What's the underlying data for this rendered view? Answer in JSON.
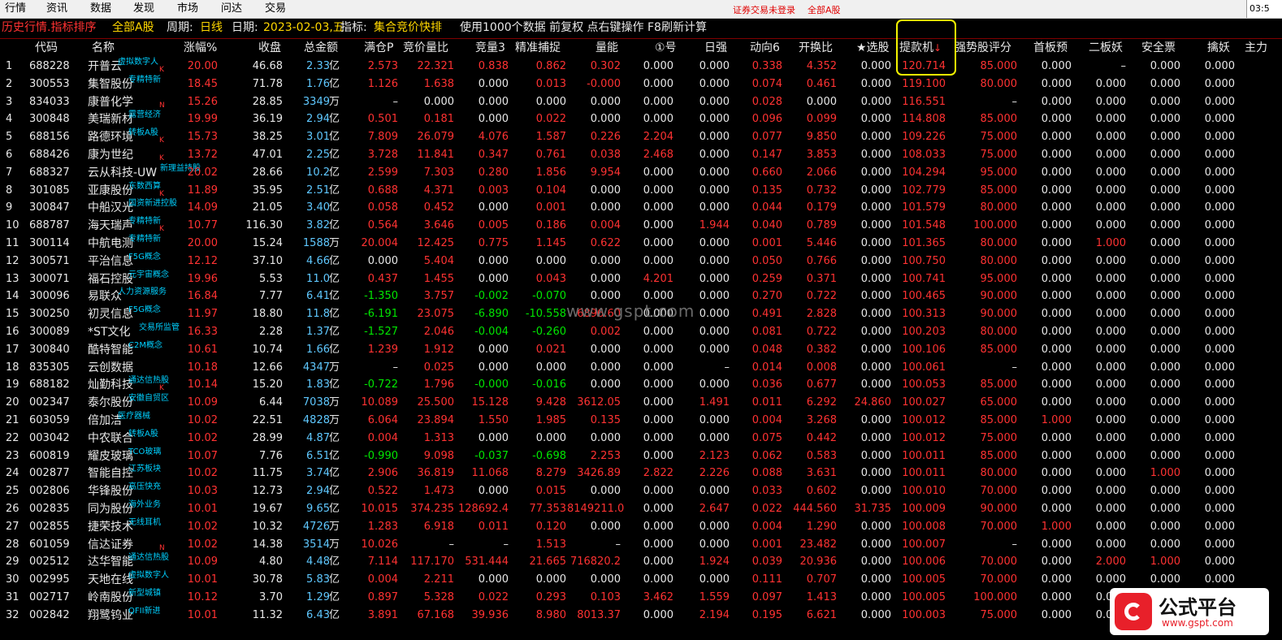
{
  "menu": {
    "items": [
      "行情",
      "资讯",
      "数据",
      "发现",
      "市场",
      "问达",
      "交易"
    ],
    "login_status": "证券交易未登录",
    "market_scope": "全部A股",
    "clock": "03:5"
  },
  "infobar": {
    "mode": "历史行情.指标排序",
    "scope": "全部A股",
    "period_label": "周期:",
    "period_value": "日线",
    "date_label": "日期:",
    "date_value": "2023-02-03,五",
    "indicator_label": "指标:",
    "indicator_value": "集合竞价快排",
    "notes": "使用1000个数据 前复权 点右键操作 F8刷新计算"
  },
  "columns": [
    "代码",
    "名称",
    "涨幅%",
    "收盘",
    "总金额",
    "满仓P",
    "竞价量比",
    "竞量3",
    "精准捕捉",
    "量能",
    "①号",
    "日强",
    "动向6",
    "开换比",
    "★选股",
    "提款机",
    "强势股评分",
    "首板预",
    "二板妖",
    "安全票",
    "擒妖",
    "主力"
  ],
  "sort_arrow": "↓",
  "watermark": "www.gspt.com",
  "logo": {
    "text": "公式平台",
    "url": "www.gspt.com"
  },
  "rows": [
    {
      "i": "1",
      "code": "688228",
      "name": "开普云",
      "tag": "虚拟数字人",
      "flag": "K",
      "chg": "20.00",
      "close": "46.68",
      "amt": "2.33",
      "unit": "亿",
      "mcp": "2.573",
      "jjlb": "22.321",
      "jl3": "0.838",
      "jzbz": "0.862",
      "ln": "0.302",
      "n1": "0.000",
      "rq": "0.000",
      "dx6": "0.338",
      "khb": "4.352",
      "xg": "0.000",
      "tkj": "120.714",
      "qsg": "85.000",
      "sbp": "0.000",
      "ebo": "–",
      "aqp": "0.000",
      "qy": "0.000"
    },
    {
      "i": "2",
      "code": "300553",
      "name": "集智股份",
      "tag": "专精特新",
      "flag": "",
      "chg": "18.45",
      "close": "71.78",
      "amt": "1.76",
      "unit": "亿",
      "mcp": "1.126",
      "jjlb": "1.638",
      "jl3": "0.000",
      "jzbz": "0.013",
      "ln": "-0.000",
      "n1": "0.000",
      "rq": "0.000",
      "dx6": "0.074",
      "khb": "0.461",
      "xg": "0.000",
      "tkj": "119.100",
      "qsg": "80.000",
      "sbp": "0.000",
      "ebo": "0.000",
      "aqp": "0.000",
      "qy": "0.000"
    },
    {
      "i": "3",
      "code": "834033",
      "name": "康普化学",
      "tag": "",
      "flag": "N",
      "chg": "15.26",
      "close": "28.85",
      "amt": "3349",
      "unit": "万",
      "mcp": "–",
      "jjlb": "0.000",
      "jl3": "0.000",
      "jzbz": "0.000",
      "ln": "0.000",
      "n1": "0.000",
      "rq": "0.000",
      "dx6": "0.028",
      "khb": "0.000",
      "xg": "0.000",
      "tkj": "116.551",
      "qsg": "–",
      "sbp": "0.000",
      "ebo": "0.000",
      "aqp": "0.000",
      "qy": "0.000"
    },
    {
      "i": "4",
      "code": "300848",
      "name": "美瑞新材",
      "tag": "露营经济",
      "flag": "",
      "chg": "19.99",
      "close": "36.19",
      "amt": "2.94",
      "unit": "亿",
      "mcp": "0.501",
      "jjlb": "0.181",
      "jl3": "0.000",
      "jzbz": "0.022",
      "ln": "0.000",
      "n1": "0.000",
      "rq": "0.000",
      "dx6": "0.096",
      "khb": "0.099",
      "xg": "0.000",
      "tkj": "114.808",
      "qsg": "85.000",
      "sbp": "0.000",
      "ebo": "0.000",
      "aqp": "0.000",
      "qy": "0.000"
    },
    {
      "i": "5",
      "code": "688156",
      "name": "路德环境",
      "tag": "转板A股",
      "flag": "K",
      "chg": "15.73",
      "close": "38.25",
      "amt": "3.01",
      "unit": "亿",
      "mcp": "7.809",
      "jjlb": "26.079",
      "jl3": "4.076",
      "jzbz": "1.587",
      "ln": "0.226",
      "n1": "2.204",
      "rq": "0.000",
      "dx6": "0.077",
      "khb": "9.850",
      "xg": "0.000",
      "tkj": "109.226",
      "qsg": "75.000",
      "sbp": "0.000",
      "ebo": "0.000",
      "aqp": "0.000",
      "qy": "0.000"
    },
    {
      "i": "6",
      "code": "688426",
      "name": "康为世纪",
      "tag": "",
      "flag": "K",
      "chg": "13.72",
      "close": "47.01",
      "amt": "2.25",
      "unit": "亿",
      "mcp": "3.728",
      "jjlb": "11.841",
      "jl3": "0.347",
      "jzbz": "0.761",
      "ln": "0.038",
      "n1": "2.468",
      "rq": "0.000",
      "dx6": "0.147",
      "khb": "3.853",
      "xg": "0.000",
      "tkj": "108.033",
      "qsg": "75.000",
      "sbp": "0.000",
      "ebo": "0.000",
      "aqp": "0.000",
      "qy": "0.000"
    },
    {
      "i": "7",
      "code": "688327",
      "name": "云从科技-UW",
      "tag": "新理益持股",
      "flag": "",
      "chg": "20.02",
      "close": "28.66",
      "amt": "10.2",
      "unit": "亿",
      "mcp": "2.599",
      "jjlb": "7.303",
      "jl3": "0.280",
      "jzbz": "1.856",
      "ln": "9.954",
      "n1": "0.000",
      "rq": "0.000",
      "dx6": "0.660",
      "khb": "2.066",
      "xg": "0.000",
      "tkj": "104.294",
      "qsg": "95.000",
      "sbp": "0.000",
      "ebo": "0.000",
      "aqp": "0.000",
      "qy": "0.000"
    },
    {
      "i": "8",
      "code": "301085",
      "name": "亚康股份",
      "tag": "东数西算",
      "flag": "K",
      "chg": "11.89",
      "close": "35.95",
      "amt": "2.51",
      "unit": "亿",
      "mcp": "0.688",
      "jjlb": "4.371",
      "jl3": "0.003",
      "jzbz": "0.104",
      "ln": "0.000",
      "n1": "0.000",
      "rq": "0.000",
      "dx6": "0.135",
      "khb": "0.732",
      "xg": "0.000",
      "tkj": "102.779",
      "qsg": "85.000",
      "sbp": "0.000",
      "ebo": "0.000",
      "aqp": "0.000",
      "qy": "0.000"
    },
    {
      "i": "9",
      "code": "300847",
      "name": "中船汉光",
      "tag": "国资新进控股",
      "flag": "",
      "chg": "14.09",
      "close": "21.05",
      "amt": "3.40",
      "unit": "亿",
      "mcp": "0.058",
      "jjlb": "0.452",
      "jl3": "0.000",
      "jzbz": "0.001",
      "ln": "0.000",
      "n1": "0.000",
      "rq": "0.000",
      "dx6": "0.044",
      "khb": "0.179",
      "xg": "0.000",
      "tkj": "101.579",
      "qsg": "80.000",
      "sbp": "0.000",
      "ebo": "0.000",
      "aqp": "0.000",
      "qy": "0.000"
    },
    {
      "i": "10",
      "code": "688787",
      "name": "海天瑞声",
      "tag": "专精特新",
      "flag": "K",
      "chg": "10.77",
      "close": "116.30",
      "amt": "3.82",
      "unit": "亿",
      "mcp": "0.564",
      "jjlb": "3.646",
      "jl3": "0.005",
      "jzbz": "0.186",
      "ln": "0.004",
      "n1": "0.000",
      "rq": "1.944",
      "dx6": "0.040",
      "khb": "0.789",
      "xg": "0.000",
      "tkj": "101.548",
      "qsg": "100.000",
      "sbp": "0.000",
      "ebo": "0.000",
      "aqp": "0.000",
      "qy": "0.000"
    },
    {
      "i": "11",
      "code": "300114",
      "name": "中航电测",
      "tag": "专精特新",
      "flag": "",
      "chg": "20.00",
      "close": "15.24",
      "amt": "1588",
      "unit": "万",
      "mcp": "20.004",
      "jjlb": "12.425",
      "jl3": "0.775",
      "jzbz": "1.145",
      "ln": "0.622",
      "n1": "0.000",
      "rq": "0.000",
      "dx6": "0.001",
      "khb": "5.446",
      "xg": "0.000",
      "tkj": "101.365",
      "qsg": "80.000",
      "sbp": "0.000",
      "ebo": "1.000",
      "aqp": "0.000",
      "qy": "0.000"
    },
    {
      "i": "12",
      "code": "300571",
      "name": "平治信息",
      "tag": "F5G概念",
      "flag": "",
      "chg": "12.12",
      "close": "37.10",
      "amt": "4.66",
      "unit": "亿",
      "mcp": "0.000",
      "jjlb": "5.404",
      "jl3": "0.000",
      "jzbz": "0.000",
      "ln": "0.000",
      "n1": "0.000",
      "rq": "0.000",
      "dx6": "0.050",
      "khb": "0.766",
      "xg": "0.000",
      "tkj": "100.750",
      "qsg": "80.000",
      "sbp": "0.000",
      "ebo": "0.000",
      "aqp": "0.000",
      "qy": "0.000"
    },
    {
      "i": "13",
      "code": "300071",
      "name": "福石控股",
      "tag": "元宇宙概念",
      "flag": "",
      "chg": "19.96",
      "close": "5.53",
      "amt": "11.0",
      "unit": "亿",
      "mcp": "0.437",
      "jjlb": "1.455",
      "jl3": "0.000",
      "jzbz": "0.043",
      "ln": "0.000",
      "n1": "4.201",
      "rq": "0.000",
      "dx6": "0.259",
      "khb": "0.371",
      "xg": "0.000",
      "tkj": "100.741",
      "qsg": "95.000",
      "sbp": "0.000",
      "ebo": "0.000",
      "aqp": "0.000",
      "qy": "0.000"
    },
    {
      "i": "14",
      "code": "300096",
      "name": "易联众",
      "tag": "人力资源服务",
      "flag": "",
      "chg": "16.84",
      "close": "7.77",
      "amt": "6.41",
      "unit": "亿",
      "mcp": "-1.350",
      "jjlb": "3.757",
      "jl3": "-0.002",
      "jzbz": "-0.070",
      "ln": "0.000",
      "n1": "0.000",
      "rq": "0.000",
      "dx6": "0.270",
      "khb": "0.722",
      "xg": "0.000",
      "tkj": "100.465",
      "qsg": "90.000",
      "sbp": "0.000",
      "ebo": "0.000",
      "aqp": "0.000",
      "qy": "0.000"
    },
    {
      "i": "15",
      "code": "300250",
      "name": "初灵信息",
      "tag": "F5G概念",
      "flag": "",
      "chg": "11.97",
      "close": "18.80",
      "amt": "11.8",
      "unit": "亿",
      "mcp": "-6.191",
      "jjlb": "23.075",
      "jl3": "-6.890",
      "jzbz": "-10.558",
      "ln": "6896.60",
      "n1": "0.000",
      "rq": "0.000",
      "dx6": "0.491",
      "khb": "2.828",
      "xg": "0.000",
      "tkj": "100.313",
      "qsg": "90.000",
      "sbp": "0.000",
      "ebo": "0.000",
      "aqp": "0.000",
      "qy": "0.000"
    },
    {
      "i": "16",
      "code": "300089",
      "name": "*ST文化",
      "tag": "交易所监管",
      "flag": "",
      "chg": "16.33",
      "close": "2.28",
      "amt": "1.37",
      "unit": "亿",
      "mcp": "-1.527",
      "jjlb": "2.046",
      "jl3": "-0.004",
      "jzbz": "-0.260",
      "ln": "0.002",
      "n1": "0.000",
      "rq": "0.000",
      "dx6": "0.081",
      "khb": "0.722",
      "xg": "0.000",
      "tkj": "100.203",
      "qsg": "80.000",
      "sbp": "0.000",
      "ebo": "0.000",
      "aqp": "0.000",
      "qy": "0.000"
    },
    {
      "i": "17",
      "code": "300840",
      "name": "酷特智能",
      "tag": "C2M概念",
      "flag": "",
      "chg": "10.61",
      "close": "10.74",
      "amt": "1.66",
      "unit": "亿",
      "mcp": "1.239",
      "jjlb": "1.912",
      "jl3": "0.000",
      "jzbz": "0.021",
      "ln": "0.000",
      "n1": "0.000",
      "rq": "0.000",
      "dx6": "0.048",
      "khb": "0.382",
      "xg": "0.000",
      "tkj": "100.106",
      "qsg": "85.000",
      "sbp": "0.000",
      "ebo": "0.000",
      "aqp": "0.000",
      "qy": "0.000"
    },
    {
      "i": "18",
      "code": "835305",
      "name": "云创数据",
      "tag": "",
      "flag": "",
      "chg": "10.18",
      "close": "12.66",
      "amt": "4347",
      "unit": "万",
      "mcp": "–",
      "jjlb": "0.025",
      "jl3": "0.000",
      "jzbz": "0.000",
      "ln": "0.000",
      "n1": "0.000",
      "rq": "–",
      "dx6": "0.014",
      "khb": "0.008",
      "xg": "0.000",
      "tkj": "100.061",
      "qsg": "–",
      "sbp": "0.000",
      "ebo": "0.000",
      "aqp": "0.000",
      "qy": "0.000"
    },
    {
      "i": "19",
      "code": "688182",
      "name": "灿勤科技",
      "tag": "通达信热股",
      "flag": "K",
      "chg": "10.14",
      "close": "15.20",
      "amt": "1.83",
      "unit": "亿",
      "mcp": "-0.722",
      "jjlb": "1.796",
      "jl3": "-0.000",
      "jzbz": "-0.016",
      "ln": "0.000",
      "n1": "0.000",
      "rq": "0.000",
      "dx6": "0.036",
      "khb": "0.677",
      "xg": "0.000",
      "tkj": "100.053",
      "qsg": "85.000",
      "sbp": "0.000",
      "ebo": "0.000",
      "aqp": "0.000",
      "qy": "0.000"
    },
    {
      "i": "20",
      "code": "002347",
      "name": "泰尔股份",
      "tag": "安徽自贸区",
      "flag": "",
      "chg": "10.09",
      "close": "6.44",
      "amt": "7038",
      "unit": "万",
      "mcp": "10.089",
      "jjlb": "25.500",
      "jl3": "15.128",
      "jzbz": "9.428",
      "ln": "3612.05",
      "n1": "0.000",
      "rq": "1.491",
      "dx6": "0.011",
      "khb": "6.292",
      "xg": "24.860",
      "tkj": "100.027",
      "qsg": "65.000",
      "sbp": "0.000",
      "ebo": "0.000",
      "aqp": "0.000",
      "qy": "0.000"
    },
    {
      "i": "21",
      "code": "603059",
      "name": "倍加洁",
      "tag": "医疗器械",
      "flag": "",
      "chg": "10.02",
      "close": "22.51",
      "amt": "4828",
      "unit": "万",
      "mcp": "6.064",
      "jjlb": "23.894",
      "jl3": "1.550",
      "jzbz": "1.985",
      "ln": "0.135",
      "n1": "0.000",
      "rq": "0.000",
      "dx6": "0.004",
      "khb": "3.268",
      "xg": "0.000",
      "tkj": "100.012",
      "qsg": "85.000",
      "sbp": "1.000",
      "ebo": "0.000",
      "aqp": "0.000",
      "qy": "0.000"
    },
    {
      "i": "22",
      "code": "003042",
      "name": "中农联合",
      "tag": "转板A股",
      "flag": "",
      "chg": "10.02",
      "close": "28.99",
      "amt": "4.87",
      "unit": "亿",
      "mcp": "0.004",
      "jjlb": "1.313",
      "jl3": "0.000",
      "jzbz": "0.000",
      "ln": "0.000",
      "n1": "0.000",
      "rq": "0.000",
      "dx6": "0.075",
      "khb": "0.442",
      "xg": "0.000",
      "tkj": "100.012",
      "qsg": "75.000",
      "sbp": "0.000",
      "ebo": "0.000",
      "aqp": "0.000",
      "qy": "0.000"
    },
    {
      "i": "23",
      "code": "600819",
      "name": "耀皮玻璃",
      "tag": "TCO玻璃",
      "flag": "",
      "chg": "10.07",
      "close": "7.76",
      "amt": "6.51",
      "unit": "亿",
      "mcp": "-0.990",
      "jjlb": "9.098",
      "jl3": "-0.037",
      "jzbz": "-0.698",
      "ln": "2.253",
      "n1": "0.000",
      "rq": "2.123",
      "dx6": "0.062",
      "khb": "0.583",
      "xg": "0.000",
      "tkj": "100.011",
      "qsg": "85.000",
      "sbp": "0.000",
      "ebo": "0.000",
      "aqp": "0.000",
      "qy": "0.000"
    },
    {
      "i": "24",
      "code": "002877",
      "name": "智能自控",
      "tag": "江苏板块",
      "flag": "",
      "chg": "10.02",
      "close": "11.75",
      "amt": "3.74",
      "unit": "亿",
      "mcp": "2.906",
      "jjlb": "36.819",
      "jl3": "11.068",
      "jzbz": "8.279",
      "ln": "3426.89",
      "n1": "2.822",
      "rq": "2.226",
      "dx6": "0.088",
      "khb": "3.631",
      "xg": "0.000",
      "tkj": "100.011",
      "qsg": "80.000",
      "sbp": "0.000",
      "ebo": "0.000",
      "aqp": "1.000",
      "qy": "0.000"
    },
    {
      "i": "25",
      "code": "002806",
      "name": "华锋股份",
      "tag": "高压快充",
      "flag": "",
      "chg": "10.03",
      "close": "12.73",
      "amt": "2.94",
      "unit": "亿",
      "mcp": "0.522",
      "jjlb": "1.473",
      "jl3": "0.000",
      "jzbz": "0.015",
      "ln": "0.000",
      "n1": "0.000",
      "rq": "0.000",
      "dx6": "0.033",
      "khb": "0.602",
      "xg": "0.000",
      "tkj": "100.010",
      "qsg": "70.000",
      "sbp": "0.000",
      "ebo": "0.000",
      "aqp": "0.000",
      "qy": "0.000"
    },
    {
      "i": "26",
      "code": "002835",
      "name": "同为股份",
      "tag": "海外业务",
      "flag": "",
      "chg": "10.01",
      "close": "19.67",
      "amt": "9.65",
      "unit": "亿",
      "mcp": "10.015",
      "jjlb": "374.235",
      "jl3": "128692.4",
      "jzbz": "77.353",
      "ln": "8149211.0",
      "n1": "0.000",
      "rq": "2.647",
      "dx6": "0.022",
      "khb": "444.560",
      "xg": "31.735",
      "tkj": "100.009",
      "qsg": "90.000",
      "sbp": "0.000",
      "ebo": "0.000",
      "aqp": "0.000",
      "qy": "0.000"
    },
    {
      "i": "27",
      "code": "002855",
      "name": "捷荣技术",
      "tag": "无线耳机",
      "flag": "",
      "chg": "10.02",
      "close": "10.32",
      "amt": "4726",
      "unit": "万",
      "mcp": "1.283",
      "jjlb": "6.918",
      "jl3": "0.011",
      "jzbz": "0.120",
      "ln": "0.000",
      "n1": "0.000",
      "rq": "0.000",
      "dx6": "0.004",
      "khb": "1.290",
      "xg": "0.000",
      "tkj": "100.008",
      "qsg": "70.000",
      "sbp": "1.000",
      "ebo": "0.000",
      "aqp": "0.000",
      "qy": "0.000"
    },
    {
      "i": "28",
      "code": "601059",
      "name": "信达证券",
      "tag": "",
      "flag": "N",
      "chg": "10.02",
      "close": "14.38",
      "amt": "3514",
      "unit": "万",
      "mcp": "10.026",
      "jjlb": "–",
      "jl3": "–",
      "jzbz": "1.513",
      "ln": "–",
      "n1": "0.000",
      "rq": "0.000",
      "dx6": "0.001",
      "khb": "23.482",
      "xg": "0.000",
      "tkj": "100.007",
      "qsg": "–",
      "sbp": "0.000",
      "ebo": "0.000",
      "aqp": "0.000",
      "qy": "0.000"
    },
    {
      "i": "29",
      "code": "002512",
      "name": "达华智能",
      "tag": "通达信热股",
      "flag": "",
      "chg": "10.09",
      "close": "4.80",
      "amt": "4.48",
      "unit": "亿",
      "mcp": "7.114",
      "jjlb": "117.170",
      "jl3": "531.444",
      "jzbz": "21.665",
      "ln": "716820.2",
      "n1": "0.000",
      "rq": "1.924",
      "dx6": "0.039",
      "khb": "20.936",
      "xg": "0.000",
      "tkj": "100.006",
      "qsg": "70.000",
      "sbp": "0.000",
      "ebo": "2.000",
      "aqp": "1.000",
      "qy": "0.000"
    },
    {
      "i": "30",
      "code": "002995",
      "name": "天地在线",
      "tag": "虚拟数字人",
      "flag": "",
      "chg": "10.01",
      "close": "30.78",
      "amt": "5.83",
      "unit": "亿",
      "mcp": "0.004",
      "jjlb": "2.211",
      "jl3": "0.000",
      "jzbz": "0.000",
      "ln": "0.000",
      "n1": "0.000",
      "rq": "0.000",
      "dx6": "0.111",
      "khb": "0.707",
      "xg": "0.000",
      "tkj": "100.005",
      "qsg": "70.000",
      "sbp": "0.000",
      "ebo": "0.000",
      "aqp": "0.000",
      "qy": "0.000"
    },
    {
      "i": "31",
      "code": "002717",
      "name": "岭南股份",
      "tag": "新型城镇",
      "flag": "",
      "chg": "10.12",
      "close": "3.70",
      "amt": "1.29",
      "unit": "亿",
      "mcp": "0.897",
      "jjlb": "5.328",
      "jl3": "0.022",
      "jzbz": "0.293",
      "ln": "0.103",
      "n1": "3.462",
      "rq": "1.559",
      "dx6": "0.097",
      "khb": "1.413",
      "xg": "0.000",
      "tkj": "100.005",
      "qsg": "100.000",
      "sbp": "0.000",
      "ebo": "0.000",
      "aqp": "0.000",
      "qy": "0.000"
    },
    {
      "i": "32",
      "code": "002842",
      "name": "翔鹭钨业",
      "tag": "QFII新进",
      "flag": "",
      "chg": "10.01",
      "close": "11.32",
      "amt": "6.43",
      "unit": "亿",
      "mcp": "3.891",
      "jjlb": "67.168",
      "jl3": "39.936",
      "jzbz": "8.980",
      "ln": "8013.37",
      "n1": "0.000",
      "rq": "2.194",
      "dx6": "0.195",
      "khb": "6.621",
      "xg": "0.000",
      "tkj": "100.003",
      "qsg": "75.000",
      "sbp": "0.000",
      "ebo": "0.000",
      "aqp": "0.000",
      "qy": "0.000"
    }
  ]
}
